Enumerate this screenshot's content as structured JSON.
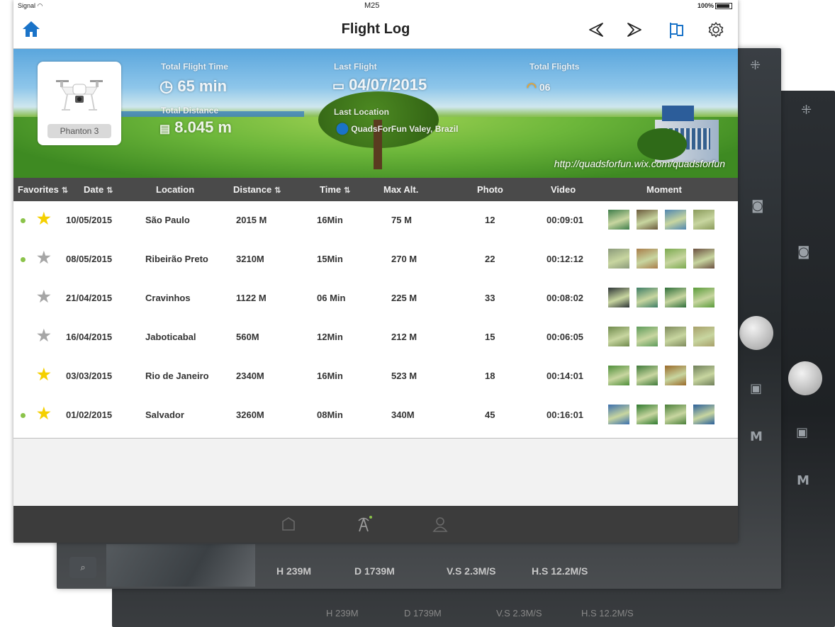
{
  "status_bar": {
    "carrier": "Signal",
    "center": "M25",
    "battery": "100%"
  },
  "header": {
    "title": "Flight Log"
  },
  "banner": {
    "drone_name": "Phanton 3",
    "total_flight_time_label": "Total Flight Time",
    "total_flight_time_value": "65 min",
    "total_distance_label": "Total Distance",
    "total_distance_value": "8.045 m",
    "last_flight_label": "Last Flight",
    "last_flight_value": "04/07/2015",
    "last_location_label": "Last Location",
    "last_location_value": "QuadsForFun Valey, Brazil",
    "total_flights_label": "Total Flights",
    "total_flights_value": "06",
    "url": "http://quadsforfun.wix.com/quadsforfun"
  },
  "table": {
    "columns": [
      "Favorites",
      "Date",
      "Location",
      "Distance",
      "Time",
      "Max Alt.",
      "Photo",
      "Video",
      "Moment"
    ],
    "rows": [
      {
        "dot": true,
        "favorite": true,
        "date": "10/05/2015",
        "location": "São Paulo",
        "distance": "2015 M",
        "time": "16Min",
        "max_alt": "75 M",
        "photo": "12",
        "video": "00:09:01"
      },
      {
        "dot": true,
        "favorite": false,
        "date": "08/05/2015",
        "location": "Ribeirão Preto",
        "distance": "3210M",
        "time": "15Min",
        "max_alt": "270 M",
        "photo": "22",
        "video": "00:12:12"
      },
      {
        "dot": false,
        "favorite": false,
        "date": "21/04/2015",
        "location": "Cravinhos",
        "distance": "1122 M",
        "time": "06 Min",
        "max_alt": "225 M",
        "photo": "33",
        "video": "00:08:02"
      },
      {
        "dot": false,
        "favorite": false,
        "date": "16/04/2015",
        "location": "Jaboticabal",
        "distance": "560M",
        "time": "12Min",
        "max_alt": "212 M",
        "photo": "15",
        "video": "00:06:05"
      },
      {
        "dot": false,
        "favorite": true,
        "date": "03/03/2015",
        "location": "Rio de Janeiro",
        "distance": "2340M",
        "time": "16Min",
        "max_alt": "523 M",
        "photo": "18",
        "video": "00:14:01"
      },
      {
        "dot": true,
        "favorite": true,
        "date": "01/02/2015",
        "location": "Salvador",
        "distance": "3260M",
        "time": "08Min",
        "max_alt": "340M",
        "photo": "45",
        "video": "00:16:01"
      }
    ]
  },
  "background_telemetry": {
    "upper": [
      "H 239M",
      "D 1739M",
      "V.S 2.3M/S",
      "H.S 12.2M/S"
    ],
    "lower": [
      "H 239M",
      "D 1739M",
      "V.S 2.3M/S",
      "H.S 12.2M/S"
    ],
    "side": "M"
  },
  "colors": {
    "accent": "#1a73c8",
    "header_bg": "#4a4a4a",
    "star_on": "#f5d000",
    "star_off": "#a6a6a6",
    "dot": "#8bc34a",
    "tabbar": "#3c3c3c"
  }
}
